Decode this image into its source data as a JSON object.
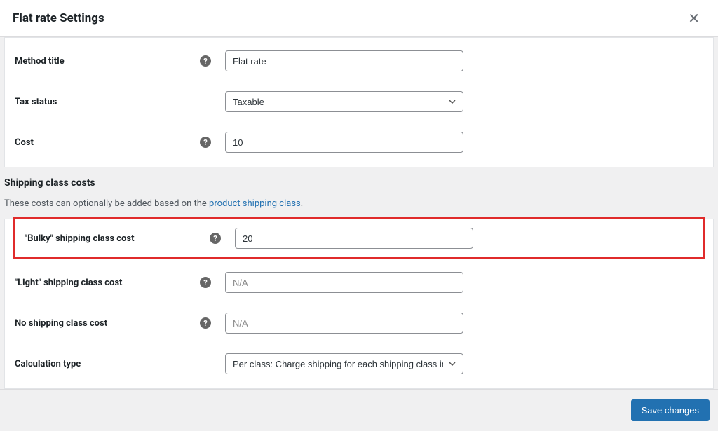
{
  "header": {
    "title": "Flat rate Settings",
    "close_icon": "✕"
  },
  "form": {
    "method_title": {
      "label": "Method title",
      "value": "Flat rate"
    },
    "tax_status": {
      "label": "Tax status",
      "value": "Taxable"
    },
    "cost": {
      "label": "Cost",
      "value": "10"
    }
  },
  "shipping_section": {
    "heading": "Shipping class costs",
    "desc_pre": "These costs can optionally be added based on the ",
    "desc_link": "product shipping class",
    "desc_post": "."
  },
  "shipping": {
    "bulky": {
      "label": "\"Bulky\" shipping class cost",
      "value": "20"
    },
    "light": {
      "label": "\"Light\" shipping class cost",
      "placeholder": "N/A",
      "value": ""
    },
    "noclass": {
      "label": "No shipping class cost",
      "placeholder": "N/A",
      "value": ""
    },
    "calc_type": {
      "label": "Calculation type",
      "value": "Per class: Charge shipping for each shipping class individually"
    }
  },
  "footer": {
    "save_label": "Save changes"
  },
  "help_glyph": "?"
}
